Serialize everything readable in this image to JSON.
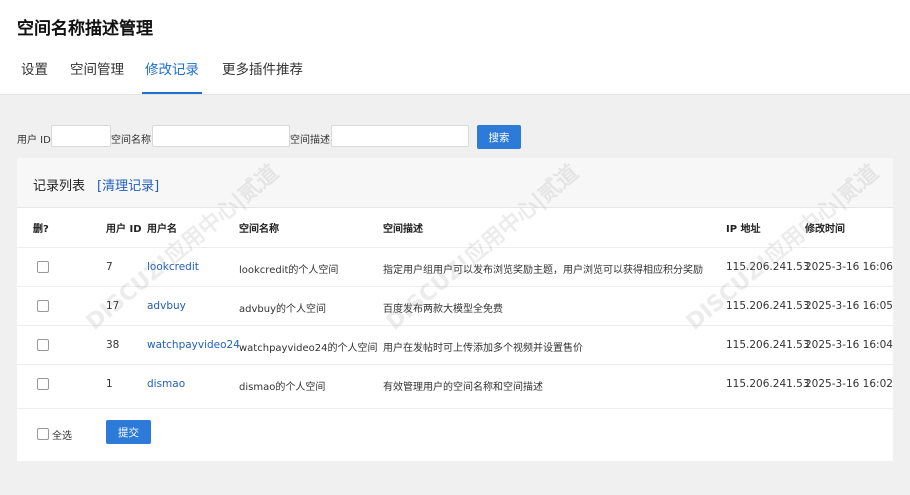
{
  "page": {
    "title": "空间名称描述管理"
  },
  "tabs": [
    {
      "label": "设置",
      "active": false
    },
    {
      "label": "空间管理",
      "active": false
    },
    {
      "label": "修改记录",
      "active": true
    },
    {
      "label": "更多插件推荐",
      "active": false
    }
  ],
  "search": {
    "uid_label": "用户 ID",
    "name_label": "空间名称",
    "desc_label": "空间描述",
    "uid_value": "",
    "name_value": "",
    "desc_value": "",
    "submit_label": "搜索"
  },
  "panel": {
    "title": "记录列表",
    "clear_label": "[清理记录]"
  },
  "table": {
    "headers": {
      "del": "删?",
      "uid": "用户 ID",
      "username": "用户名",
      "space_name": "空间名称",
      "space_desc": "空间描述",
      "ip": "IP 地址",
      "time": "修改时间"
    },
    "rows": [
      {
        "uid": "7",
        "username": "lookcredit",
        "space_name": "lookcredit的个人空间",
        "space_desc": "指定用户组用户可以发布浏览奖励主题，用户浏览可以获得相应积分奖励",
        "ip": "115.206.241.53",
        "time": "2025-3-16 16:06"
      },
      {
        "uid": "17",
        "username": "advbuy",
        "space_name": "advbuy的个人空间",
        "space_desc": "百度发布两款大模型全免费",
        "ip": "115.206.241.53",
        "time": "2025-3-16 16:05"
      },
      {
        "uid": "38",
        "username": "watchpayvideo24",
        "space_name": "watchpayvideo24的个人空间",
        "space_desc": "用户在发帖时可上传添加多个视频并设置售价",
        "ip": "115.206.241.53",
        "time": "2025-3-16 16:04"
      },
      {
        "uid": "1",
        "username": "dismao",
        "space_name": "dismao的个人空间",
        "space_desc": "有效管理用户的空间名称和空间描述",
        "ip": "115.206.241.53",
        "time": "2025-3-16 16:02"
      }
    ]
  },
  "footer": {
    "select_all_label": "全选",
    "submit_label": "提交"
  },
  "watermark": {
    "text": "DISCUZ!应用中心|贰道"
  }
}
